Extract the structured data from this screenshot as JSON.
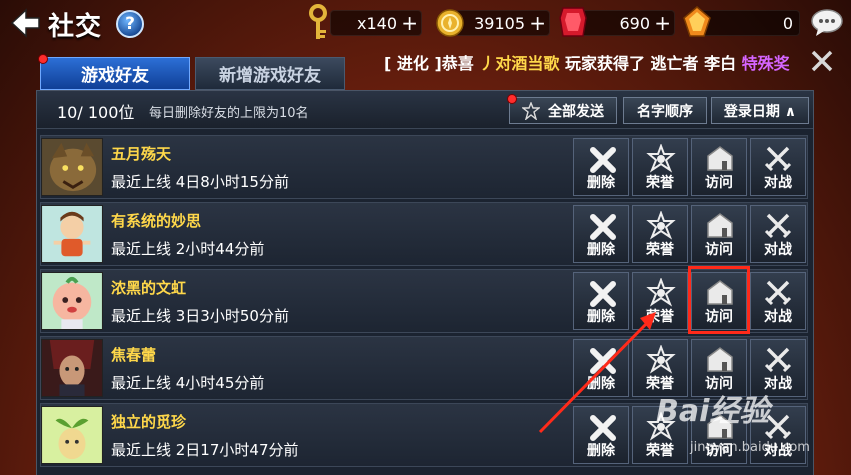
{
  "header": {
    "title": "社交",
    "back_icon": "back-arrow-icon",
    "help_label": "?",
    "resources": [
      {
        "name": "key",
        "icon": "key-icon",
        "value": "x140"
      },
      {
        "name": "gold",
        "icon": "gold-coin-icon",
        "value": "39105"
      },
      {
        "name": "gem",
        "icon": "red-gem-icon",
        "value": "690"
      },
      {
        "name": "crystal",
        "icon": "orange-crystal-icon",
        "value": "0"
      }
    ],
    "plus_label": "+",
    "chat_icon": "chat-bubble-icon"
  },
  "tabs": [
    {
      "label": "游戏好友",
      "active": true
    },
    {
      "label": "新增游戏好友",
      "active": false
    }
  ],
  "ticker": {
    "tag": "[ 进化 ]",
    "p1": "恭喜 ",
    "p2": "丿对酒当歌",
    "p3": " 玩家获得了 逃亡者 李白 ",
    "p4": "特殊奖"
  },
  "panel": {
    "count": "10/ 100位",
    "note": "每日删除好友的上限为10名",
    "send_all": "全部发送",
    "sort_name": "名字顺序",
    "sort_login": "登录日期 ∧"
  },
  "actions": {
    "delete": "删除",
    "honor": "荣誉",
    "visit": "访问",
    "battle": "对战"
  },
  "friends": [
    {
      "name": "五月殇天",
      "last_online": "最近上线 4日8小时15分前"
    },
    {
      "name": "有系统的妙思",
      "last_online": "最近上线 2小时44分前"
    },
    {
      "name": "浓黑的文虹",
      "last_online": "最近上线 3日3小时50分前"
    },
    {
      "name": "焦春蕾",
      "last_online": "最近上线 4小时45分前"
    },
    {
      "name": "独立的觅珍",
      "last_online": "最近上线 2日17小时47分前"
    }
  ],
  "watermark": {
    "text": "Bai经验",
    "sub": "jingyan.baidu.com"
  },
  "colors": {
    "accent_blue": "#2c6fd6",
    "name_yellow": "#ffd84a",
    "highlight_red": "#ff2a1a"
  }
}
